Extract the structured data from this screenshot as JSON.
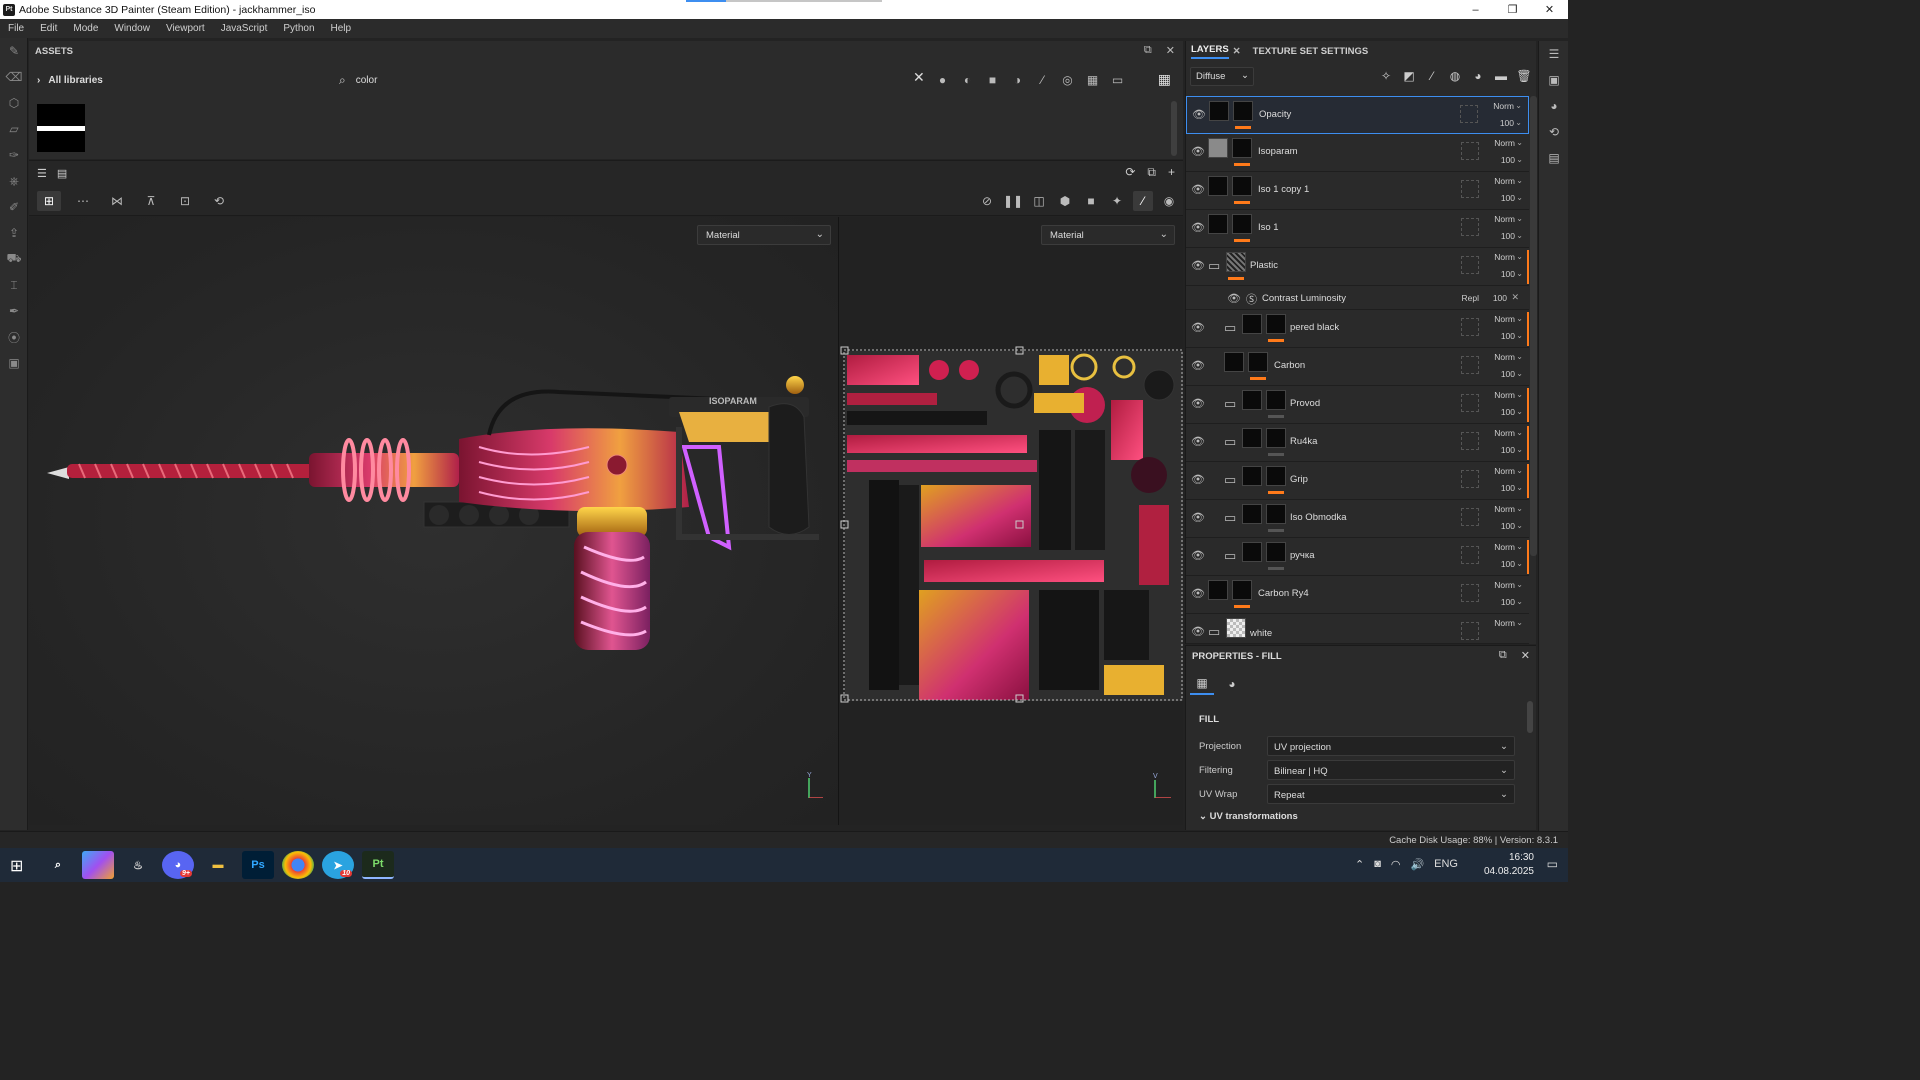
{
  "window": {
    "title": "Adobe Substance 3D Painter (Steam Edition) - jackhammer_iso",
    "app_icon": "Pt",
    "controls": {
      "minimize": "–",
      "maximize": "❐",
      "close": "✕"
    }
  },
  "menu": [
    "File",
    "Edit",
    "Mode",
    "Window",
    "Viewport",
    "JavaScript",
    "Python",
    "Help"
  ],
  "assets": {
    "title": "ASSETS",
    "library": "All libraries",
    "search_value": "color"
  },
  "viewport": {
    "left_mode": "Material",
    "right_mode": "Material",
    "label_3d": "ISOPARAM",
    "axis_3d": {
      "y": "Y",
      "x": "X"
    },
    "axis_2d": {
      "v": "V",
      "u": "U"
    }
  },
  "layers_panel": {
    "tab_layers": "LAYERS",
    "tab_texture": "TEXTURE SET SETTINGS",
    "channel": "Diffuse",
    "items": [
      {
        "name": "Opacity",
        "blend": "Norm",
        "opacity": "100"
      },
      {
        "name": "Isoparam",
        "blend": "Norm",
        "opacity": "100"
      },
      {
        "name": "Iso 1 copy 1",
        "blend": "Norm",
        "opacity": "100"
      },
      {
        "name": "Iso 1",
        "blend": "Norm",
        "opacity": "100"
      },
      {
        "name": "Plastic",
        "blend": "Norm",
        "opacity": "100"
      },
      {
        "name": "pered black",
        "blend": "Norm",
        "opacity": "100"
      },
      {
        "name": "Carbon",
        "blend": "Norm",
        "opacity": "100"
      },
      {
        "name": "Provod",
        "blend": "Norm",
        "opacity": "100"
      },
      {
        "name": "Ru4ka",
        "blend": "Norm",
        "opacity": "100"
      },
      {
        "name": "Grip",
        "blend": "Norm",
        "opacity": "100"
      },
      {
        "name": "Iso Obmodka",
        "blend": "Norm",
        "opacity": "100"
      },
      {
        "name": "ручка",
        "blend": "Norm",
        "opacity": "100"
      },
      {
        "name": "Carbon Ry4",
        "blend": "Norm",
        "opacity": "100"
      },
      {
        "name": "white",
        "blend": "Norm",
        "opacity": ""
      }
    ],
    "effect": {
      "name": "Contrast Luminosity",
      "blend": "Repl",
      "opacity": "100"
    }
  },
  "properties": {
    "title": "PROPERTIES - FILL",
    "section": "FILL",
    "projection_label": "Projection",
    "projection_value": "UV projection",
    "filtering_label": "Filtering",
    "filtering_value": "Bilinear | HQ",
    "uvwrap_label": "UV Wrap",
    "uvwrap_value": "Repeat",
    "uv_transform": "UV transformations"
  },
  "status": {
    "text": "Cache Disk Usage:  88% | Version: 8.3.1"
  },
  "taskbar": {
    "time": "16:30",
    "date": "04.08.2025",
    "lang": "ENG",
    "apps": [
      "Copilot",
      "Steam",
      "Discord",
      "Explorer",
      "Ps",
      "Chrome",
      "Telegram",
      "Pt"
    ],
    "badge_discord": "9+",
    "badge_telegram": "10"
  }
}
